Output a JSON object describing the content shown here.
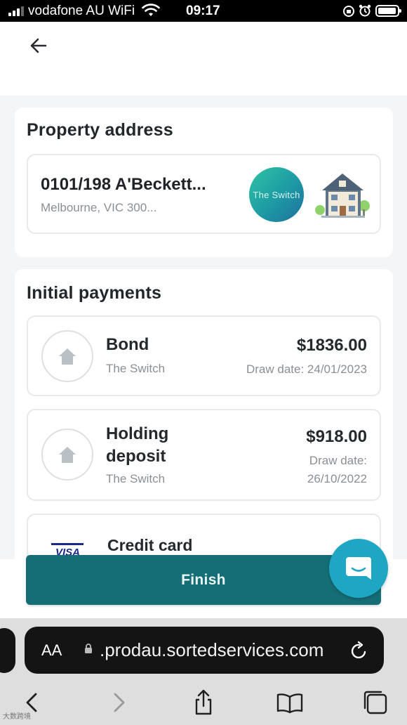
{
  "status_bar": {
    "carrier": "vodafone AU WiFi",
    "time": "09:17"
  },
  "property": {
    "title": "Property address",
    "address_line1": "0101/198 A'Beckett...",
    "address_line2": "Melbourne, VIC 300...",
    "logo_text": "The Switch"
  },
  "payments": {
    "title": "Initial payments",
    "items": [
      {
        "name": "Bond",
        "sub": "The Switch",
        "amount": "$1836.00",
        "date": "Draw date: 24/01/2023"
      },
      {
        "name": "Holding deposit",
        "sub": "The Switch",
        "amount": "$918.00",
        "date": "Draw date: 26/10/2022"
      }
    ],
    "card": {
      "name": "Credit card",
      "brand": "VISA"
    }
  },
  "finish_label": "Finish",
  "browser": {
    "aa": "AA",
    "url": ".prodau.sortedservices.com"
  },
  "colors": {
    "accent": "#156e76",
    "chat": "#1fa6c3"
  },
  "watermark": "大数跨境"
}
